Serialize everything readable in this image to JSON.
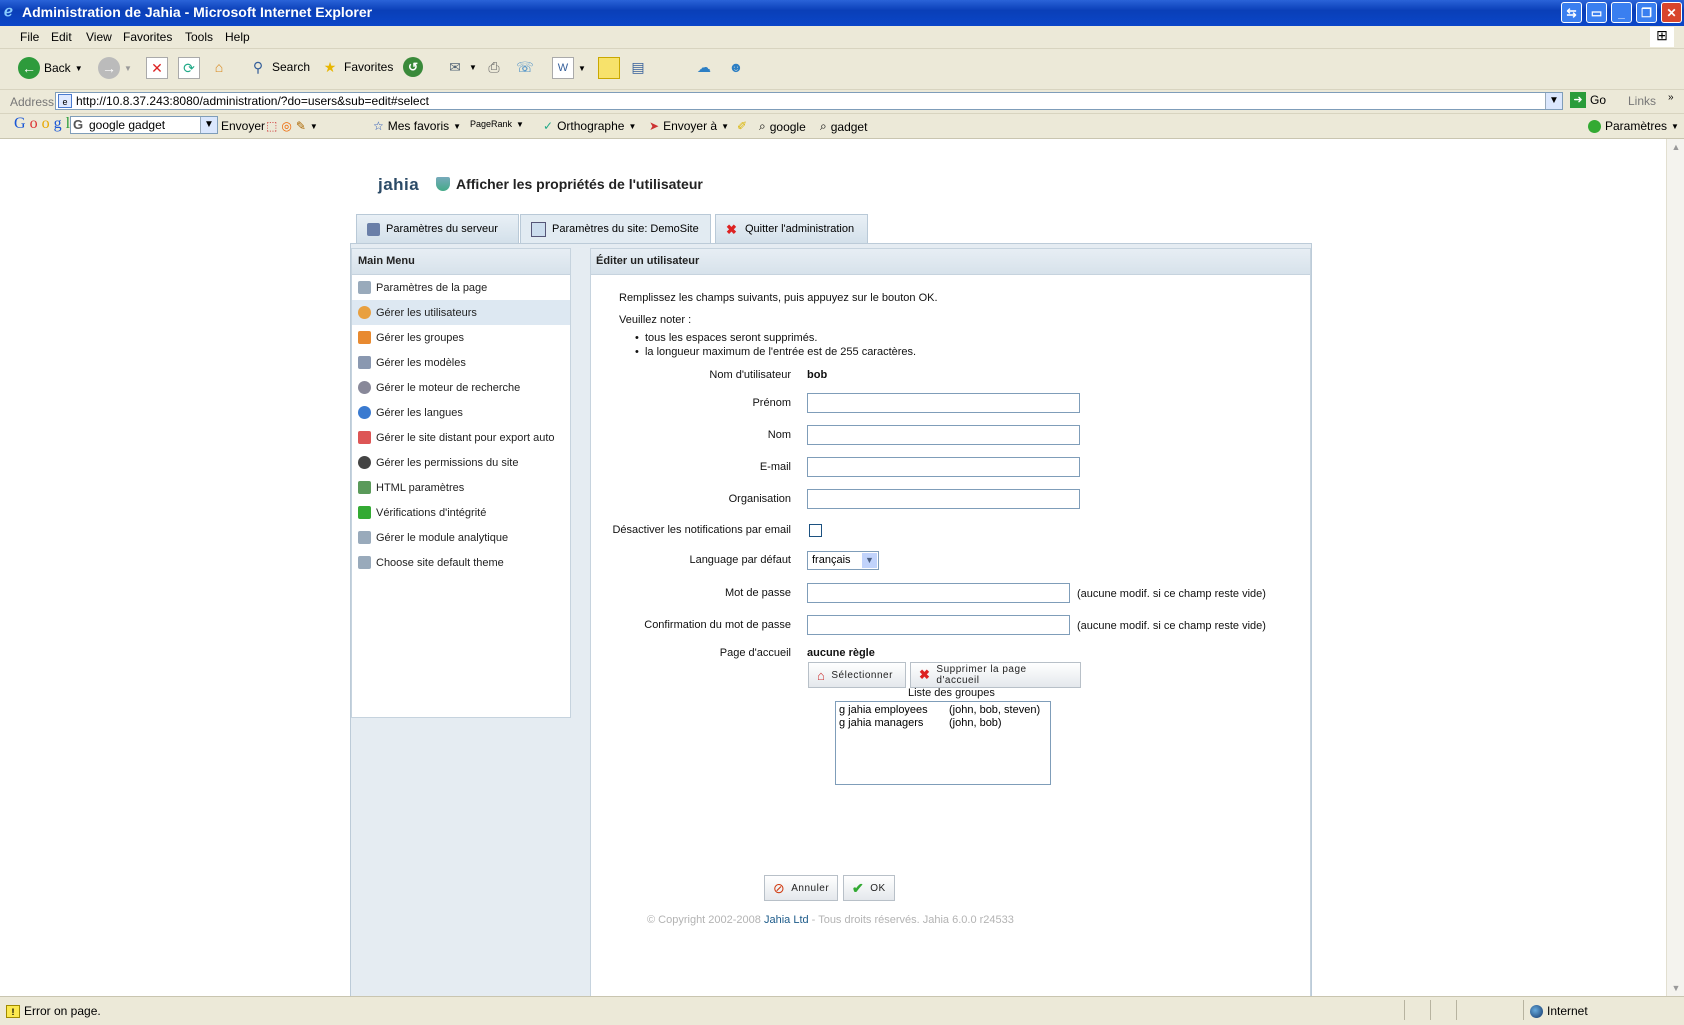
{
  "window": {
    "title": "Administration de Jahia - Microsoft Internet Explorer",
    "controls": [
      "⇆",
      "▭",
      "_",
      "❐",
      "✕"
    ]
  },
  "menubar": [
    "File",
    "Edit",
    "View",
    "Favorites",
    "Tools",
    "Help"
  ],
  "toolbar": {
    "back": "Back",
    "search": "Search",
    "favorites": "Favorites"
  },
  "address": {
    "label": "Address",
    "url": "http://10.8.37.243:8080/administration/?do=users&sub=edit#select",
    "go": "Go",
    "links": "Links"
  },
  "googlebar": {
    "logo": [
      "G",
      "o",
      "o",
      "g",
      "l",
      "e"
    ],
    "search_value": "google gadget",
    "envoyer": "Envoyer",
    "mes_favoris": "Mes favoris",
    "pagerank": "PageRank",
    "orthographe": "Orthographe",
    "envoyer_a": "Envoyer à",
    "google": "google",
    "gadget": "gadget",
    "parametres": "Paramètres"
  },
  "page": {
    "logo": "jahia",
    "heading": "Afficher les propriétés de l'utilisateur",
    "tabs": [
      {
        "label": "Paramètres du serveur",
        "icon": "server-icon"
      },
      {
        "label": "Paramètres du site: DemoSite",
        "icon": "site-icon"
      },
      {
        "label": "Quitter l'administration",
        "icon": "close-icon"
      }
    ],
    "main_menu": {
      "title": "Main Menu",
      "items": [
        "Paramètres de la page",
        "Gérer les utilisateurs",
        "Gérer les groupes",
        "Gérer les modèles",
        "Gérer le moteur de recherche",
        "Gérer les langues",
        "Gérer le site distant pour export auto",
        "Gérer les permissions du site",
        "HTML paramètres",
        "Vérifications d'intégrité",
        "Gérer le module analytique",
        "Choose site default theme"
      ],
      "selected_index": 1
    },
    "panel": {
      "title": "Éditer un utilisateur",
      "intro": "Remplissez les champs suivants, puis appuyez sur le bouton OK.",
      "note_title": "Veuillez noter :",
      "notes": [
        "tous les espaces seront supprimés.",
        "la longueur maximum de l'entrée est de 255 caractères."
      ],
      "username_label": "Nom d'utilisateur",
      "username_value": "bob",
      "firstname_label": "Prénom",
      "lastname_label": "Nom",
      "email_label": "E-mail",
      "organisation_label": "Organisation",
      "disable_notif_label": "Désactiver les notifications par email",
      "language_label": "Language par défaut",
      "language_value": "français",
      "password_label": "Mot de passe",
      "password_hint": "(aucune modif. si ce champ reste vide)",
      "confirm_label": "Confirmation du mot de passe",
      "confirm_hint": "(aucune modif. si ce champ reste vide)",
      "homepage_label": "Page d'accueil",
      "homepage_value": "aucune règle",
      "select_button": "Sélectionner",
      "remove_homepage_button": "Supprimer la page d'accueil",
      "groups_title": "Liste des groupes",
      "groups": [
        {
          "name": "g jahia  employees",
          "members": "(john, bob, steven)"
        },
        {
          "name": "g jahia  managers",
          "members": "(john, bob)"
        }
      ]
    },
    "buttons": {
      "cancel": "Annuler",
      "ok": "OK"
    },
    "copyright_prefix": "© Copyright 2002-2008",
    "copyright_link": "Jahia Ltd",
    "copyright_suffix": " - Tous droits réservés. Jahia 6.0.0 r24533"
  },
  "status": {
    "error": "Error on page.",
    "zone": "Internet"
  }
}
